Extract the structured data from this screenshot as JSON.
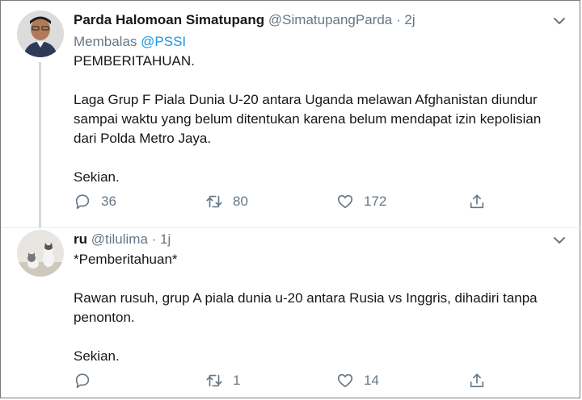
{
  "tweets": [
    {
      "name": "Parda Halomoan Simatupang",
      "handle": "@SimatupangParda",
      "dot": "·",
      "time": "2j",
      "replying_prefix": "Membalas",
      "replying_mention": "@PSSI",
      "paragraphs": [
        "PEMBERITAHUAN.",
        "Laga Grup F Piala Dunia U-20 antara Uganda melawan Afghanistan diundur sampai waktu yang belum ditentukan karena belum mendapat izin kepolisian dari Polda Metro Jaya.",
        "Sekian."
      ],
      "replies": "36",
      "retweets": "80",
      "likes": "172"
    },
    {
      "name": "ru",
      "handle": "@tilulima",
      "dot": "·",
      "time": "1j",
      "paragraphs": [
        "*Pemberitahuan*",
        "Rawan rusuh, grup A piala dunia u-20 antara Rusia vs Inggris, dihadiri tanpa penonton.",
        "Sekian."
      ],
      "replies": "",
      "retweets": "1",
      "likes": "14"
    }
  ],
  "icons": {
    "reply": "reply-icon",
    "retweet": "retweet-icon",
    "like": "heart-icon",
    "share": "share-icon",
    "more": "chevron-down-icon"
  },
  "colors": {
    "text": "#14171a",
    "secondary": "#657786",
    "link": "#1b95e0",
    "thread_line": "#cfd9de"
  }
}
